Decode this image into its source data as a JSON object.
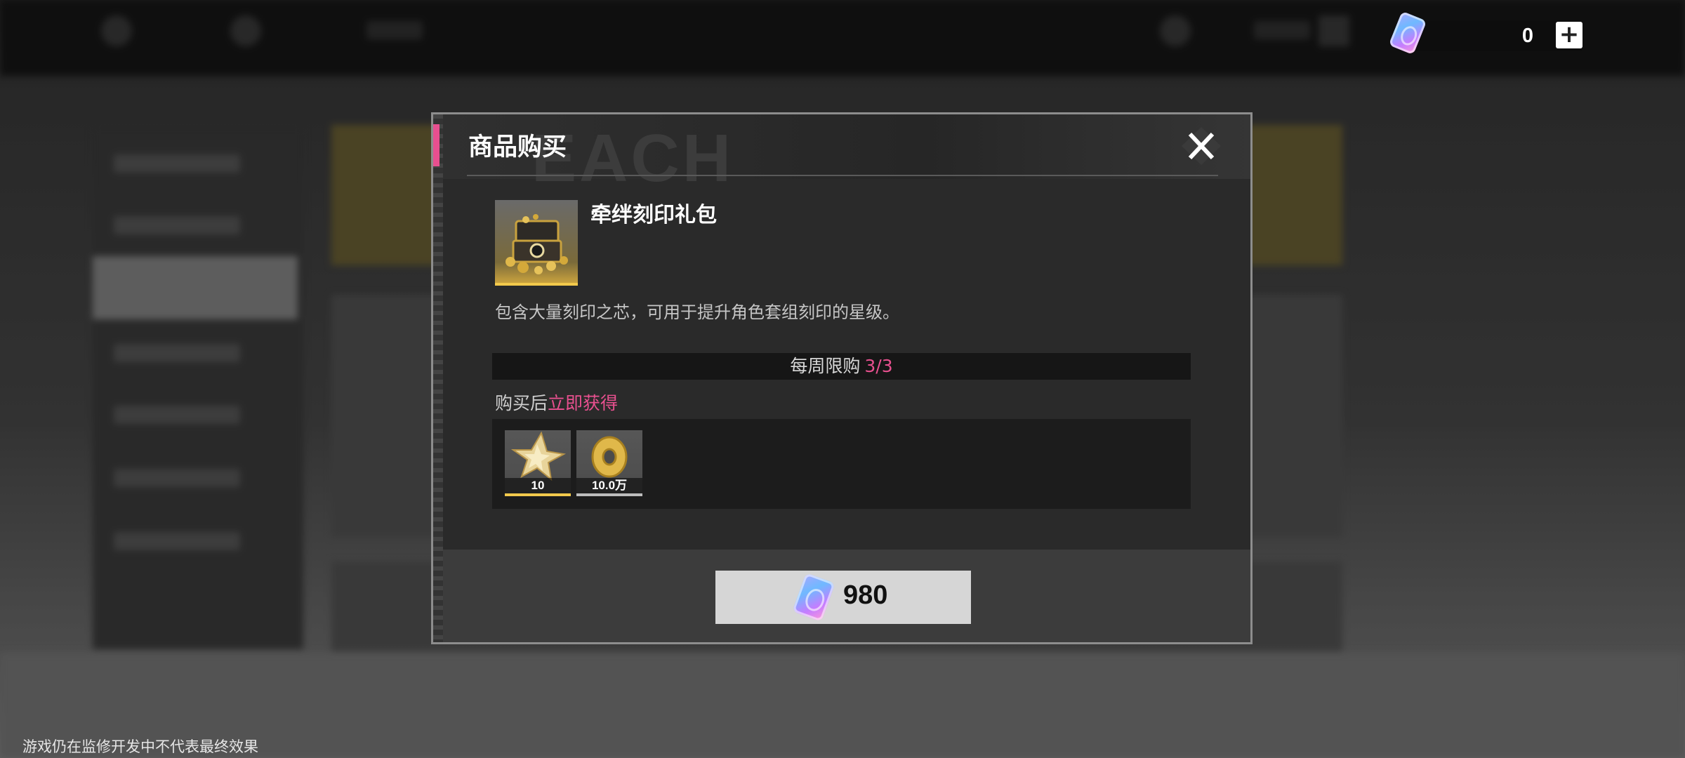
{
  "currency": {
    "amount": "0",
    "add_label": "+"
  },
  "modal": {
    "title": "商品购买",
    "watermark": "EACH",
    "close_icon": "close-icon",
    "product": {
      "name": "牵绊刻印礼包",
      "icon": "treasure-chest-icon",
      "description": "包含大量刻印之芯，可用于提升角色套组刻印的星级。"
    },
    "weekly_limit": {
      "label": "每周限购",
      "count": "3/3"
    },
    "after_purchase": {
      "prefix": "购买后",
      "highlight": "立即获得"
    },
    "rewards": [
      {
        "icon": "star-crystal-icon",
        "quantity": "10"
      },
      {
        "icon": "gold-coin-icon",
        "quantity": "10.0万"
      }
    ],
    "buy_button": {
      "icon": "crystal-icon",
      "price": "980"
    }
  },
  "footer": {
    "disclaimer": "游戏仍在监修开发中不代表最终效果"
  },
  "colors": {
    "accent": "#e8508f",
    "gold": "#f2c94c",
    "modal_bg": "#2a2a2a"
  }
}
